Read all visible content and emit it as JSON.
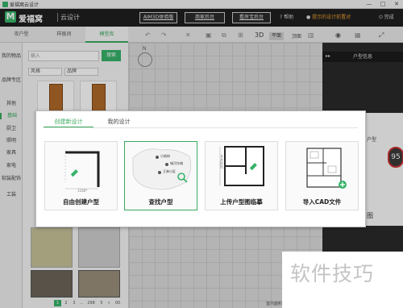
{
  "window": {
    "title": "爱福窝云设计",
    "controls": [
      "—",
      "□",
      "✕"
    ]
  },
  "header": {
    "logo_mark": "M",
    "logo_text": "爱福窝",
    "logo_sub": "云设计",
    "buttons": [
      "AIM3D体验版",
      "商家后台",
      "看房宝后台"
    ],
    "help": "帮助",
    "user": "提示的设计前置对",
    "done": "完成"
  },
  "left_tabs": [
    {
      "label": "攻户型"
    },
    {
      "label": "样板间"
    },
    {
      "label": "模型库"
    }
  ],
  "sidebar": {
    "items": [
      "我的物品",
      "品牌专区",
      "其他",
      "基础",
      "厨卫",
      "照明",
      "家具",
      "家电",
      "软装配饰",
      "工装"
    ],
    "active": "基础"
  },
  "catalog": {
    "search_placeholder": "输入",
    "search_button": "搜索",
    "filters": [
      "风格",
      "品牌"
    ],
    "pager": [
      "1",
      "2",
      "3",
      "...",
      "298",
      "5",
      "»",
      "00"
    ]
  },
  "toolbar": {
    "mode_3d": "3D",
    "mode_flat": "平面",
    "mode_top": "顶面"
  },
  "canvas": {
    "compass_label": "N",
    "status": "室内面积 ..."
  },
  "right_panel": {
    "title": "户型信息",
    "collapse": "▸▸",
    "zoom": "95",
    "mid_text": "图",
    "side_label": "户型"
  },
  "dialog": {
    "tabs": [
      {
        "label": "创建新设计"
      },
      {
        "label": "我的设计"
      }
    ],
    "cards": [
      {
        "label": "自由创建户型",
        "dim": "1160*"
      },
      {
        "label": "查找户型",
        "pins": [
          "小结构",
          "城河东城",
          "王林小区"
        ]
      },
      {
        "label": "上传户型图临摹",
        "dim": "2000mm"
      },
      {
        "label": "导入CAD文件"
      }
    ]
  },
  "watermark": "软件技巧"
}
